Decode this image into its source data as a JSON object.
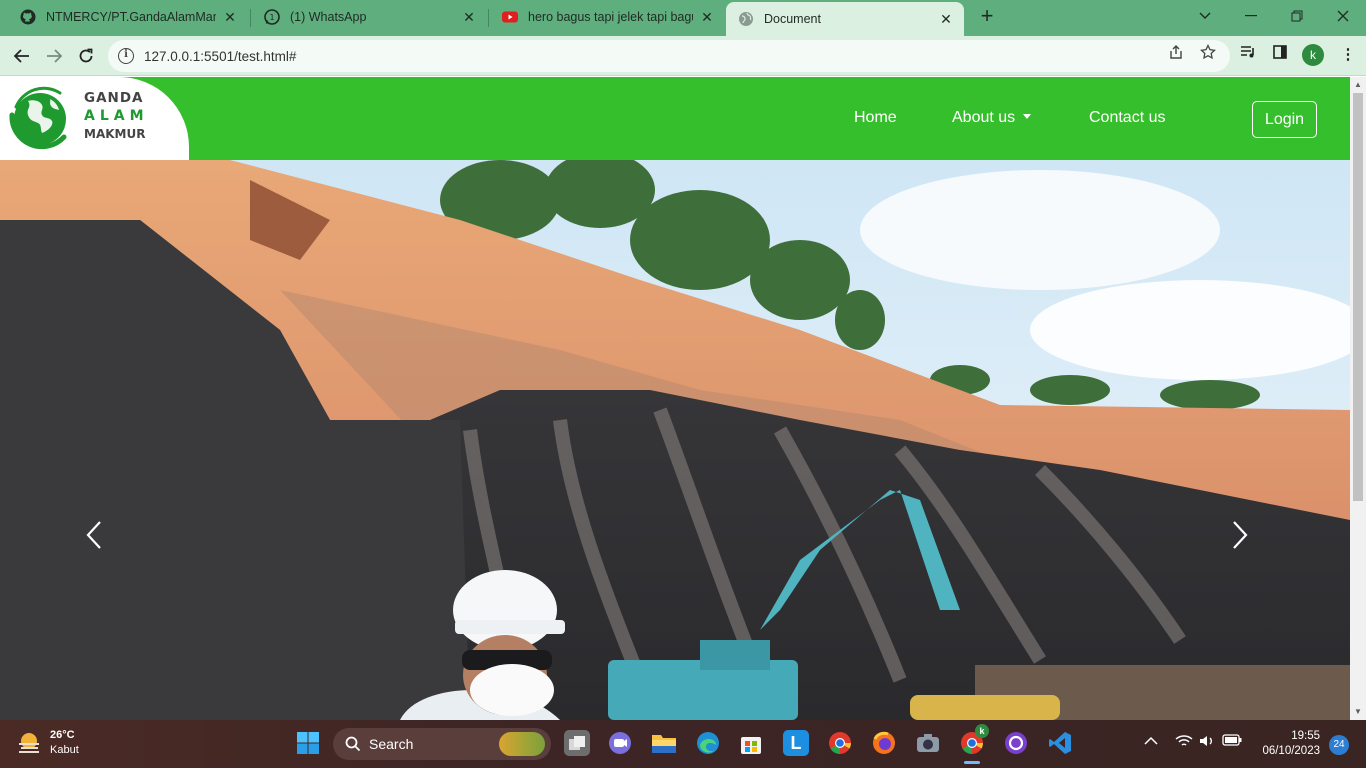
{
  "browser": {
    "tabs": [
      {
        "title": "NTMERCY/PT.GandaAlamMandiri",
        "icon": "github-icon"
      },
      {
        "title": "(1) WhatsApp",
        "icon": "whatsapp-icon"
      },
      {
        "title": "hero bagus tapi jelek tapi bagus",
        "icon": "youtube-icon"
      },
      {
        "title": "Document",
        "icon": "globe-icon"
      }
    ],
    "url": "127.0.0.1:5501/test.html#",
    "profile_initial": "k"
  },
  "site": {
    "logo": {
      "line1": "GANDA",
      "line2": "ALAM",
      "line3": "MAKMUR"
    },
    "nav": {
      "home": "Home",
      "about": "About us",
      "contact": "Contact us",
      "login": "Login"
    },
    "colors": {
      "nav_bg": "#36bf2c",
      "logo_green": "#1f9a2e"
    }
  },
  "taskbar": {
    "weather_temp": "26°C",
    "weather_desc": "Kabut",
    "search_label": "Search",
    "time": "19:55",
    "date": "06/10/2023",
    "notification_count": "24",
    "chrome_badge": "k"
  }
}
